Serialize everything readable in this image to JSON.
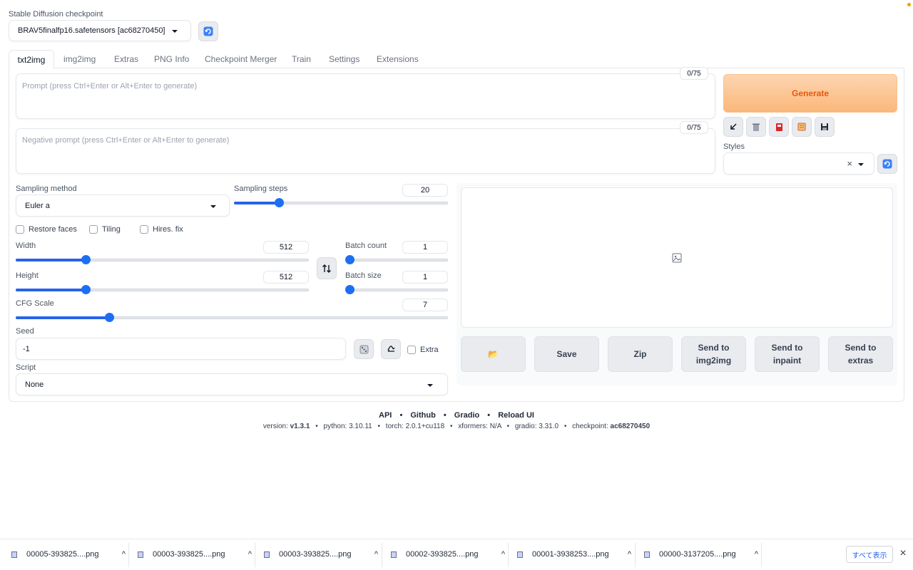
{
  "checkpoint": {
    "label": "Stable Diffusion checkpoint",
    "value": "BRAV5finalfp16.safetensors [ac68270450]"
  },
  "tabs": [
    {
      "label": "txt2img",
      "active": true
    },
    {
      "label": "img2img"
    },
    {
      "label": "Extras"
    },
    {
      "label": "PNG Info"
    },
    {
      "label": "Checkpoint Merger"
    },
    {
      "label": "Train"
    },
    {
      "label": "Settings"
    },
    {
      "label": "Extensions"
    }
  ],
  "prompt": {
    "placeholder": "Prompt (press Ctrl+Enter or Alt+Enter to generate)",
    "token_count": "0/75"
  },
  "negative_prompt": {
    "placeholder": "Negative prompt (press Ctrl+Enter or Alt+Enter to generate)",
    "token_count": "0/75"
  },
  "generate_label": "Generate",
  "tool_icons": [
    "arrow-diagonal-icon",
    "trash-icon",
    "red-card-icon",
    "notebook-icon",
    "save-floppy-icon"
  ],
  "styles": {
    "label": "Styles",
    "clear": "×"
  },
  "sampling": {
    "method_label": "Sampling method",
    "method_value": "Euler a",
    "steps_label": "Sampling steps",
    "steps_value": "20",
    "steps_fraction": 0.2
  },
  "checkboxes": {
    "restore_faces": "Restore faces",
    "tiling": "Tiling",
    "hires": "Hires. fix",
    "extra": "Extra"
  },
  "width": {
    "label": "Width",
    "value": "512",
    "fraction": 0.23
  },
  "height": {
    "label": "Height",
    "value": "512",
    "fraction": 0.23
  },
  "batch_count": {
    "label": "Batch count",
    "value": "1",
    "fraction": 0
  },
  "batch_size": {
    "label": "Batch size",
    "value": "1",
    "fraction": 0
  },
  "cfg": {
    "label": "CFG Scale",
    "value": "7",
    "fraction": 0.21
  },
  "seed": {
    "label": "Seed",
    "value": "-1"
  },
  "script": {
    "label": "Script",
    "value": "None"
  },
  "output_buttons": {
    "folder": "📂",
    "save": "Save",
    "zip": "Zip",
    "img2img": "Send to\nimg2img",
    "inpaint": "Send to\ninpaint",
    "extras": "Send to\nextras"
  },
  "footer": {
    "links": [
      "API",
      "Github",
      "Gradio",
      "Reload UI"
    ],
    "bullet": "•",
    "version_label": "version:",
    "version": "v1.3.1",
    "python": "python: 3.10.11",
    "torch": "torch: 2.0.1+cu118",
    "xformers": "xformers: N/A",
    "gradio": "gradio: 3.31.0",
    "checkpoint_label": "checkpoint:",
    "checkpoint": "ac68270450"
  },
  "downloads": {
    "items": [
      "00005-393825....png",
      "00003-393825....png",
      "00003-393825....png",
      "00002-393825....png",
      "00001-3938253....png",
      "00000-3137205....png"
    ],
    "show_all": "すべて表示",
    "close": "×"
  },
  "colors": {
    "accent": "#2563eb",
    "generate_start": "#fdd5b1",
    "generate_end": "#fbb77a",
    "generate_text": "#ea580c"
  }
}
